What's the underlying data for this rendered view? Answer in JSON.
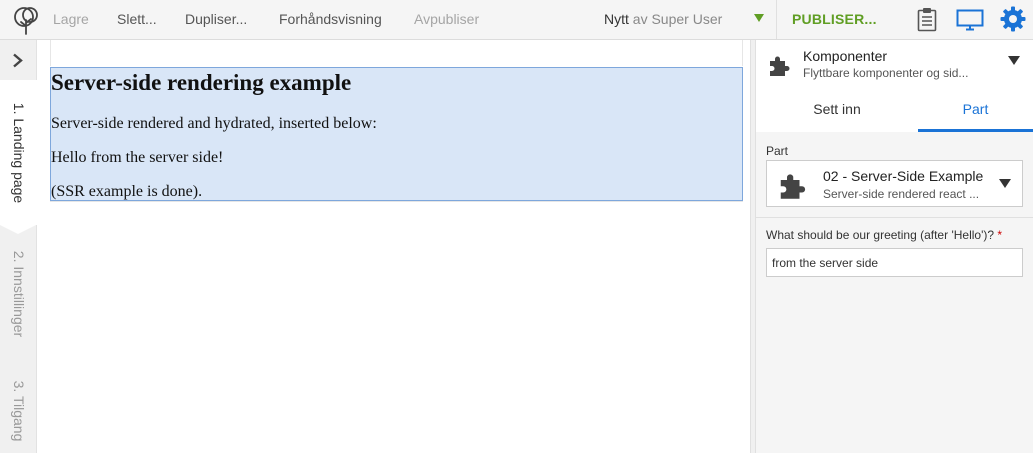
{
  "toolbar": {
    "save_label": "Lagre",
    "delete_label": "Slett...",
    "duplicate_label": "Dupliser...",
    "preview_label": "Forhåndsvisning",
    "unpublish_label": "Avpubliser",
    "status": "Nytt",
    "by_user": "av Super User",
    "publish_label": "PUBLISER...",
    "icons": [
      "app-logo-icon",
      "clipboard-icon",
      "monitor-icon",
      "gear-icon"
    ],
    "colors": {
      "publish": "#609e24",
      "accent": "#1a73d6"
    }
  },
  "wizard": {
    "steps": [
      {
        "label": "1. Landing page",
        "active": true
      },
      {
        "label": "2. Innstillinger",
        "active": false
      },
      {
        "label": "3. Tilgang",
        "active": false
      }
    ]
  },
  "page": {
    "heading": "Server-side rendering example",
    "line1": "Server-side rendered and hydrated, inserted below:",
    "line2": "Hello from the server side!",
    "line3": "(SSR example is done)."
  },
  "panel": {
    "title": "Komponenter",
    "subtitle": "Flyttbare komponenter og sid...",
    "tabs": {
      "insert": "Sett inn",
      "part": "Part"
    },
    "part_label": "Part",
    "part_name": "02 - Server-Side Example",
    "part_desc": "Server-side rendered react ...",
    "greeting_label": "What should be our greeting (after 'Hello')?",
    "required_mark": "*",
    "greeting_value": "from the server side"
  }
}
